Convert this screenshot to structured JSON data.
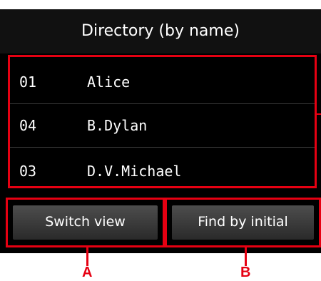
{
  "title": "Directory (by name)",
  "entries": [
    {
      "number": "01",
      "name": "Alice"
    },
    {
      "number": "04",
      "name": "B.Dylan"
    },
    {
      "number": "03",
      "name": "D.V.Michael"
    }
  ],
  "buttons": {
    "switch_view": "Switch view",
    "find_by_initial": "Find by initial"
  },
  "callouts": {
    "a": "A",
    "b": "B"
  },
  "colors": {
    "highlight": "#e60012",
    "screen_bg": "#000000",
    "text": "#ffffff"
  }
}
